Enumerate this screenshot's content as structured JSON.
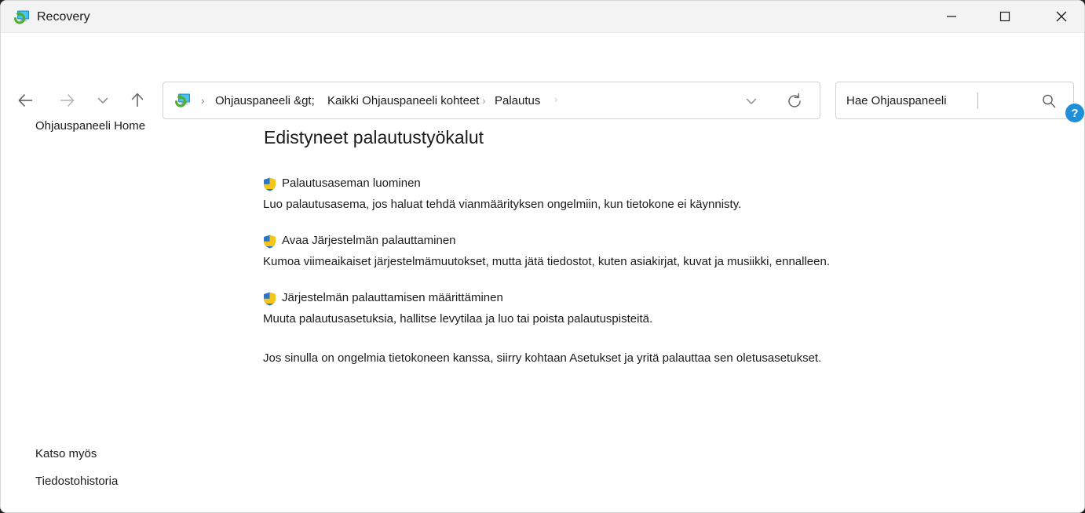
{
  "window": {
    "title": "Recovery",
    "icon": "recovery-monitor-icon",
    "controls": {
      "minimize": "—",
      "maximize": "☐",
      "close": "×"
    }
  },
  "nav": {
    "back": "back-arrow",
    "forward": "forward-arrow",
    "recent": "chevron-down",
    "up": "up-arrow"
  },
  "address": {
    "icon": "recovery-monitor-icon",
    "separator_1": "›",
    "separator_2": "›",
    "crumbs": [
      "Ohjauspaneeli &gt;",
      "Kaikki Ohjauspaneeli kohteet",
      "Palautus"
    ],
    "trailing_caret": "›",
    "dropdown_icon": "chevron-down-icon",
    "refresh_icon": "refresh-icon"
  },
  "search": {
    "value": "Hae Ohjauspaneeli",
    "placeholder": "Hae Ohjauspaneeli",
    "icon": "search-icon"
  },
  "help": {
    "label": "?"
  },
  "sidebar": {
    "home": "Ohjauspaneeli Home",
    "see_also_heading": "Katso myös",
    "items": [
      {
        "label": "Tiedostohistoria"
      }
    ]
  },
  "main": {
    "title": "Edistyneet palautustyökalut",
    "tasks": [
      {
        "icon": "uac-shield-icon",
        "link": "Palautusaseman luominen",
        "description": "Luo palautusasema, jos haluat tehdä vianmäärityksen ongelmiin, kun tietokone ei käynnisty."
      },
      {
        "icon": "uac-shield-icon",
        "link": "Avaa Järjestelmän palauttaminen",
        "description": "Kumoa viimeaikaiset järjestelmämuutokset, mutta jätä tiedostot, kuten asiakirjat, kuvat ja musiikki, ennalleen."
      },
      {
        "icon": "uac-shield-icon",
        "link": "Järjestelmän palauttamisen määrittäminen",
        "description": "Muuta palautusasetuksia, hallitse levytilaa ja luo tai poista palautuspisteitä."
      }
    ],
    "footer_note": "Jos sinulla on ongelmia tietokoneen kanssa, siirry kohtaan Asetukset ja yritä palauttaa sen oletusasetukset."
  },
  "colors": {
    "titlebar_bg": "#f3f3f3",
    "body_bg": "#ffffff",
    "text": "#1b1b1b",
    "help_blue": "#1f8fd8",
    "shield_blue": "#2b77c4",
    "shield_yellow": "#f5c518"
  }
}
